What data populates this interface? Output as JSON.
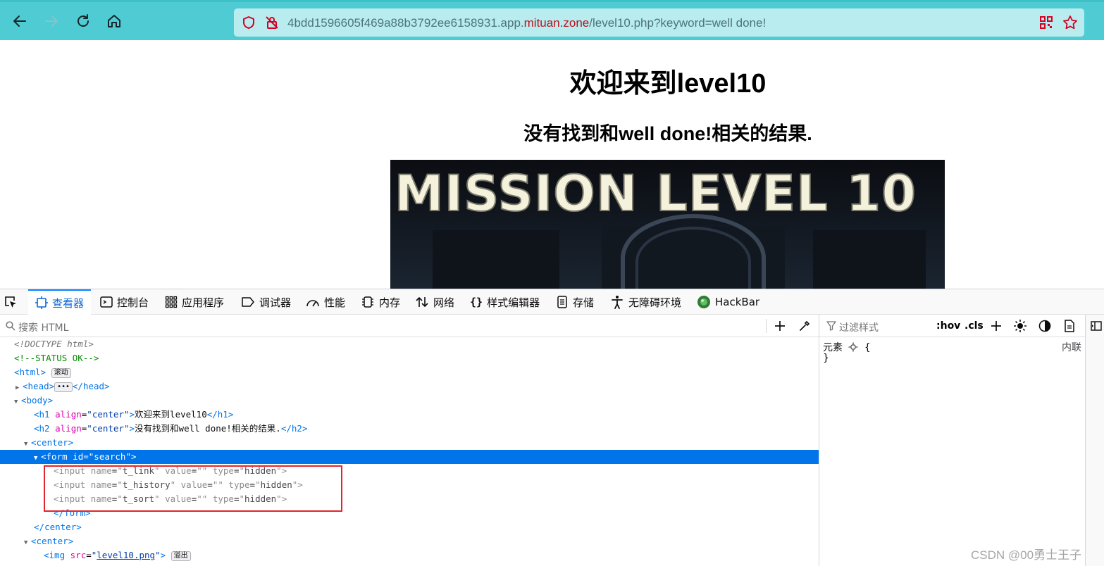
{
  "browser": {
    "url_prefix": "4bdd1596605f469a88b3792ee6158931.app.",
    "url_domain": "mituan.zone",
    "url_path": "/level10.php?keyword=well done!",
    "accent": "#4fcbd3"
  },
  "page": {
    "h1": "欢迎来到level10",
    "h2": "没有找到和well done!相关的结果.",
    "banner_text": "MISSION LEVEL 10"
  },
  "devtools": {
    "tabs": [
      {
        "label": "查看器",
        "icon": "inspector-icon"
      },
      {
        "label": "控制台",
        "icon": "console-icon"
      },
      {
        "label": "应用程序",
        "icon": "application-icon"
      },
      {
        "label": "调试器",
        "icon": "debugger-icon"
      },
      {
        "label": "性能",
        "icon": "performance-icon"
      },
      {
        "label": "内存",
        "icon": "memory-icon"
      },
      {
        "label": "网络",
        "icon": "network-icon"
      },
      {
        "label": "样式编辑器",
        "icon": "style-editor-icon"
      },
      {
        "label": "存储",
        "icon": "storage-icon"
      },
      {
        "label": "无障碍环境",
        "icon": "accessibility-icon"
      },
      {
        "label": "HackBar",
        "icon": "hackbar-icon"
      }
    ],
    "search_placeholder": "搜索 HTML",
    "filter_placeholder": "过滤样式",
    "hov": ":hov",
    "cls": ".cls",
    "rule_selector": "元素",
    "rule_open": "{",
    "rule_close": "}",
    "rule_source": "内联",
    "html_tree": {
      "doctype": "<!DOCTYPE html>",
      "comment": "<!--STATUS OK-->",
      "html": "html",
      "html_badge": "滚动",
      "head": "head",
      "head_badge": "•••",
      "body": "body",
      "h1_tag": "h1",
      "align_attr": "align",
      "center_val": "center",
      "h1_text": "欢迎来到level10",
      "h2_tag": "h2",
      "h2_text": "没有找到和well done!相关的结果.",
      "center_tag": "center",
      "form_tag": "form",
      "id_attr": "id",
      "form_id": "search",
      "inputs": [
        {
          "name": "t_link",
          "value": "",
          "type": "hidden"
        },
        {
          "name": "t_history",
          "value": "",
          "type": "hidden"
        },
        {
          "name": "t_sort",
          "value": "",
          "type": "hidden"
        }
      ],
      "img_tag": "img",
      "img_src": "level10.png",
      "img_badge": "溢出"
    }
  },
  "watermark": "CSDN @00勇士王子"
}
